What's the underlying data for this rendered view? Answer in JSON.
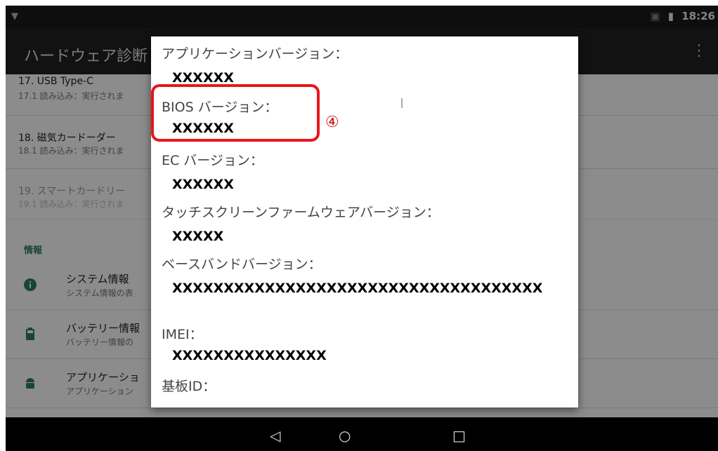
{
  "status": {
    "time": "18:26"
  },
  "appbar": {
    "title": "ハードウェア診断"
  },
  "background_list": {
    "items": [
      {
        "title": "17. USB Type-C",
        "sub": "17.1 読み込み：実行されま"
      },
      {
        "title": "18. 磁気カードーダー",
        "sub": "18.1 読み込み：実行されま"
      },
      {
        "title": "19. スマートカードリー",
        "sub": "19.1 読み込み：実行されま"
      }
    ],
    "section": "情報",
    "info_items": [
      {
        "title": "システム情報",
        "sub": "システム情報の表"
      },
      {
        "title": "バッテリー情報",
        "sub": "バッテリー情報の"
      },
      {
        "title": "アプリケーショ",
        "sub": "アプリケーション"
      }
    ]
  },
  "dialog": {
    "app_version_label": "アプリケーションバージョン：",
    "app_version_value": "XXXXXX",
    "bios_label": "BIOS バージョン：",
    "bios_value": "XXXXXX",
    "ec_label": "EC バージョン：",
    "ec_value": "XXXXXX",
    "touch_label": "タッチスクリーンファームウェアバージョン：",
    "touch_value": "XXXXX",
    "baseband_label": "ベースバンドバージョン：",
    "baseband_value": "XXXXXXXXXXXXXXXXXXXXXXXXXXXXXXXXXXXX",
    "imei_label": "IMEI：",
    "imei_value": "XXXXXXXXXXXXXXX",
    "board_label": "基板ID："
  },
  "annotation": {
    "marker": "④",
    "color": "#e8161b"
  },
  "navbar": {
    "back": "◁",
    "home": "○",
    "recent": "□"
  }
}
